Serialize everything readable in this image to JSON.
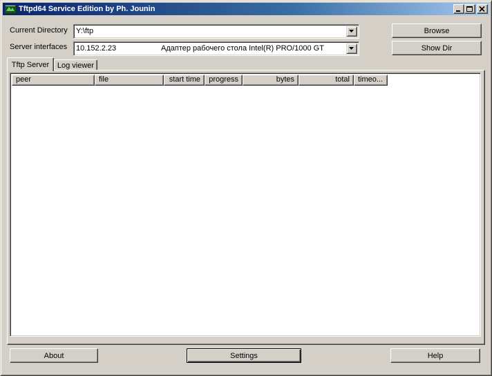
{
  "window": {
    "title": "Tftpd64 Service Edition by Ph. Jounin"
  },
  "form": {
    "current_directory_label": "Current Directory",
    "current_directory_value": "Y:\\ftp",
    "server_interfaces_label": "Server interfaces",
    "server_interface_ip": "10.152.2.23",
    "server_interface_adapter": "Адаптер рабочего стола Intel(R) PRO/1000 GT"
  },
  "buttons": {
    "browse": "Browse",
    "show_dir": "Show Dir",
    "about": "About",
    "settings": "Settings",
    "help": "Help"
  },
  "tabs": [
    {
      "label": "Tftp Server",
      "active": true
    },
    {
      "label": "Log viewer",
      "active": false
    }
  ],
  "table": {
    "columns": [
      "peer",
      "file",
      "start time",
      "progress",
      "bytes",
      "total",
      "timeo..."
    ],
    "rows": []
  },
  "icons": {
    "app": "tftpd-app-icon",
    "minimize": "minimize-icon",
    "maximize": "maximize-icon",
    "close": "close-icon",
    "dropdown": "chevron-down-icon"
  },
  "colors": {
    "title_start": "#0a246a",
    "title_end": "#a6caf0",
    "face": "#d4d0c8"
  }
}
